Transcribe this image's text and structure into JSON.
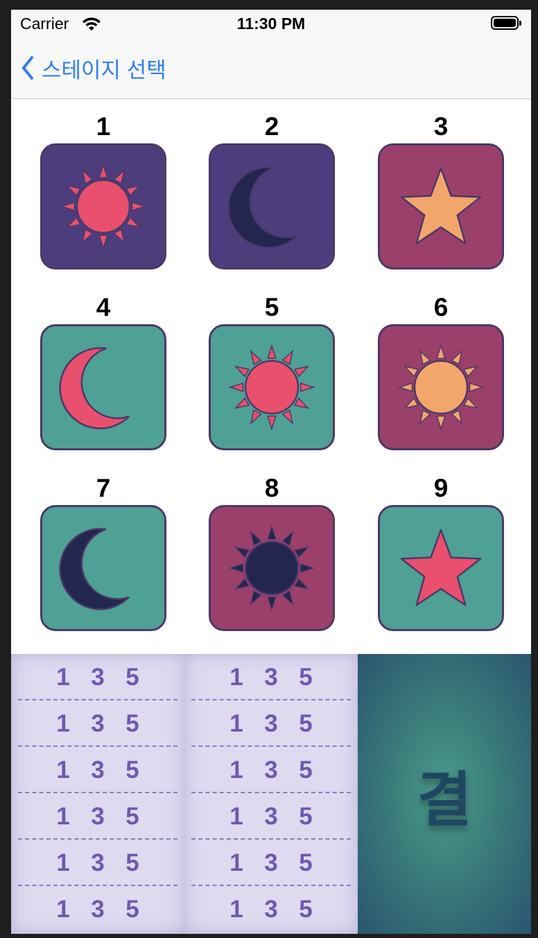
{
  "status_bar": {
    "carrier": "Carrier",
    "time": "11:30 PM"
  },
  "nav": {
    "back_label": "스테이지 선택"
  },
  "stages": [
    {
      "number": "1",
      "icon": "sun-icon",
      "bg": "#4e3d7d",
      "fill": "#e8506e"
    },
    {
      "number": "2",
      "icon": "moon-icon",
      "bg": "#4e3d7d",
      "fill": "#23264f"
    },
    {
      "number": "3",
      "icon": "star-icon",
      "bg": "#9b406a",
      "fill": "#f3a66b"
    },
    {
      "number": "4",
      "icon": "moon-icon",
      "bg": "#4fa095",
      "fill": "#e8506e"
    },
    {
      "number": "5",
      "icon": "sun-icon",
      "bg": "#4fa095",
      "fill": "#e8506e"
    },
    {
      "number": "6",
      "icon": "sun-icon",
      "bg": "#9b406a",
      "fill": "#f3a66b"
    },
    {
      "number": "7",
      "icon": "moon-icon",
      "bg": "#4fa095",
      "fill": "#23264f"
    },
    {
      "number": "8",
      "icon": "sun-icon",
      "bg": "#9b406a",
      "fill": "#23264f"
    },
    {
      "number": "9",
      "icon": "star-icon",
      "bg": "#4fa095",
      "fill": "#e8506e"
    }
  ],
  "banner": {
    "col1": [
      [
        "1",
        "3",
        "5"
      ],
      [
        "1",
        "3",
        "5"
      ],
      [
        "1",
        "3",
        "5"
      ],
      [
        "1",
        "3",
        "5"
      ],
      [
        "1",
        "3",
        "5"
      ],
      [
        "1",
        "3",
        "5"
      ]
    ],
    "col2": [
      [
        "1",
        "3",
        "5"
      ],
      [
        "1",
        "3",
        "5"
      ],
      [
        "1",
        "3",
        "5"
      ],
      [
        "1",
        "3",
        "5"
      ],
      [
        "1",
        "3",
        "5"
      ],
      [
        "1",
        "3",
        "5"
      ]
    ],
    "result_text": "결"
  },
  "colors": {
    "accent": "#2f7ff5",
    "outline": "#4a3968"
  }
}
